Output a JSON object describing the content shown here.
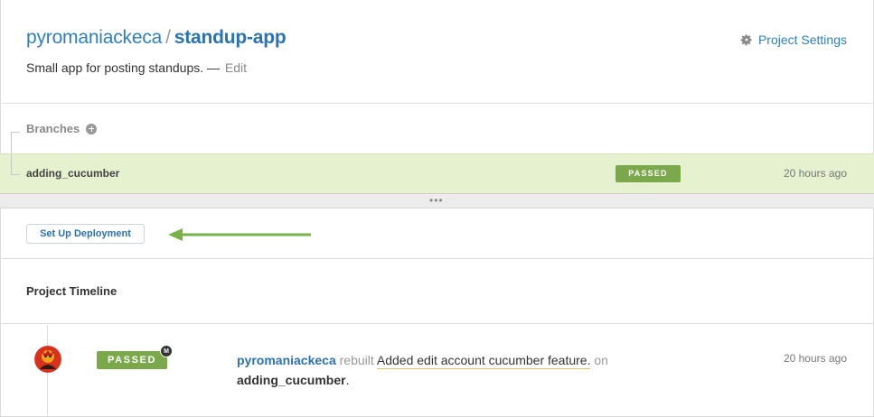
{
  "header": {
    "owner": "pyromaniackeca",
    "separator": "/",
    "repo": "standup-app",
    "description": "Small app for posting standups. —",
    "edit_label": "Edit",
    "settings_label": "Project Settings",
    "settings_icon": "gear-icon"
  },
  "branches": {
    "label": "Branches",
    "add_icon": "plus-circle-icon",
    "items": [
      {
        "name": "adding_cucumber",
        "status": "PASSED",
        "time": "20 hours ago"
      }
    ]
  },
  "divider": {
    "dots": "•••"
  },
  "deployment": {
    "button_label": "Set Up Deployment",
    "arrow_color": "#7ab24a"
  },
  "timeline": {
    "title": "Project Timeline",
    "entries": [
      {
        "status": "PASSED",
        "badge": "M",
        "user": "pyromaniackeca",
        "action": "rebuilt",
        "message": "Added edit account cucumber feature.",
        "preposition": "on",
        "branch": "adding_cucumber",
        "branch_suffix": ".",
        "time": "20 hours ago"
      }
    ]
  },
  "colors": {
    "link": "#2a72b5",
    "passed": "#7aa84a",
    "branch_row_bg": "#e6f2cf"
  }
}
